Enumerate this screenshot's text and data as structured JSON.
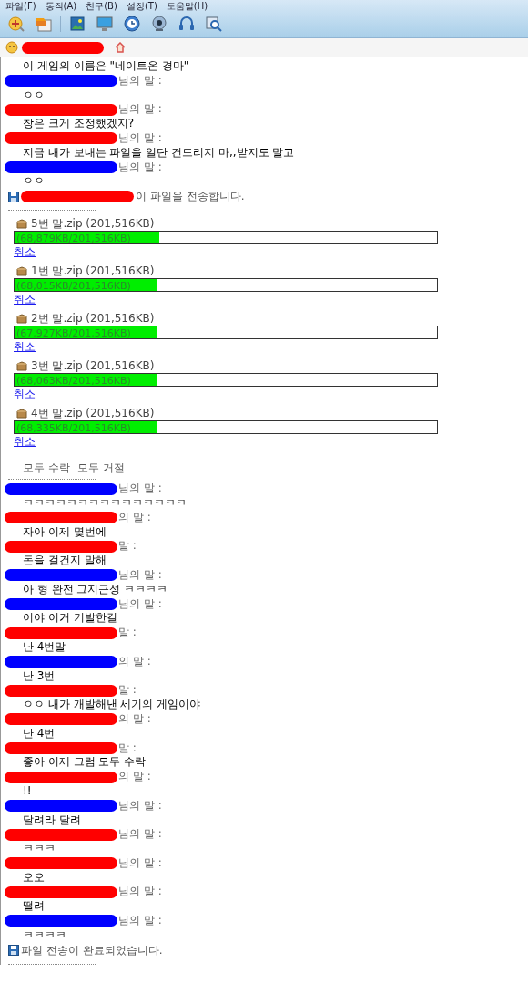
{
  "menu": [
    "파일(F)",
    "동작(A)",
    "친구(B)",
    "설정(T)",
    "도움말(H)"
  ],
  "contact_bar": {
    "color": "#ff0000"
  },
  "log": [
    {
      "kind": "message",
      "text": "이 게임의 이름은 \"네이트온 경마\""
    },
    {
      "kind": "header",
      "color": "#0000ff",
      "text": "님의 말 :"
    },
    {
      "kind": "message",
      "text": "ㅇㅇ"
    },
    {
      "kind": "header",
      "color": "#ff0000",
      "text": "님의 말 :"
    },
    {
      "kind": "message",
      "text": "창은 크게 조정했겠지?"
    },
    {
      "kind": "header",
      "color": "#ff0000",
      "text": "님의 말 :"
    },
    {
      "kind": "message",
      "text": "지금 내가 보내는 파일을 일단 건드리지 마,,받지도 말고"
    },
    {
      "kind": "header",
      "color": "#0000ff",
      "text": "님의 말 :"
    },
    {
      "kind": "message",
      "text": "ㅇㅇ"
    },
    {
      "kind": "system",
      "color": "#ff0000",
      "text": "이 파일을 전송합니다."
    },
    {
      "kind": "separator"
    }
  ],
  "transfers": [
    {
      "file": "5번 말.zip (201,516KB)",
      "progress": "(68,879KB/201,516KB)",
      "level": 0.342,
      "cancel": "취소"
    },
    {
      "file": "1번 말.zip (201,516KB)",
      "progress": "(68,015KB/201,516KB)",
      "level": 0.338,
      "cancel": "취소"
    },
    {
      "file": "2번 말.zip (201,516KB)",
      "progress": "(67,927KB/201,516KB)",
      "level": 0.337,
      "cancel": "취소"
    },
    {
      "file": "3번 말.zip (201,516KB)",
      "progress": "(68,063KB/201,516KB)",
      "level": 0.338,
      "cancel": "취소"
    },
    {
      "file": "4번 말.zip (201,516KB)",
      "progress": "(68,335KB/201,516KB)",
      "level": 0.339,
      "cancel": "취소"
    }
  ],
  "transfer_actions": [
    "모두 수락",
    "모두 거절"
  ],
  "log_after": [
    {
      "kind": "separator"
    },
    {
      "kind": "header",
      "color": "#0000ff",
      "text": "님의 말 :"
    },
    {
      "kind": "message",
      "text": "ㅋㅋㅋㅋㅋㅋㅋㅋㅋㅋㅋㅋㅋㅋㅋ"
    },
    {
      "kind": "header",
      "color": "#ff0000",
      "text": "의 말 :"
    },
    {
      "kind": "message",
      "text": "자아 이제 몇번에"
    },
    {
      "kind": "header",
      "color": "#ff0000",
      "text": "말 :"
    },
    {
      "kind": "message",
      "text": "돈을 걸건지 말해"
    },
    {
      "kind": "header",
      "color": "#0000ff",
      "text": "님의 말 :"
    },
    {
      "kind": "message",
      "text": "아 형 완전 그지근성 ㅋㅋㅋㅋ"
    },
    {
      "kind": "header",
      "color": "#0000ff",
      "text": "님의 말 :"
    },
    {
      "kind": "message",
      "text": "이야 이거 기발한걸"
    },
    {
      "kind": "header",
      "color": "#ff0000",
      "text": "말 :"
    },
    {
      "kind": "message",
      "text": "난 4번말"
    },
    {
      "kind": "header",
      "color": "#0000ff",
      "text": "의 말 :"
    },
    {
      "kind": "message",
      "text": "난 3번"
    },
    {
      "kind": "header",
      "color": "#ff0000",
      "text": "말 :"
    },
    {
      "kind": "message",
      "text": "ㅇㅇ 내가 개발해낸 세기의 게임이야"
    },
    {
      "kind": "header",
      "color": "#ff0000",
      "text": "의 말 :"
    },
    {
      "kind": "message",
      "text": "난 4번"
    },
    {
      "kind": "header",
      "color": "#ff0000",
      "text": "말 :"
    },
    {
      "kind": "message",
      "text": "좋아 이제 그럼 모두 수락"
    },
    {
      "kind": "header",
      "color": "#ff0000",
      "text": "의 말 :"
    },
    {
      "kind": "message",
      "text": "!!"
    },
    {
      "kind": "header",
      "color": "#0000ff",
      "text": "님의 말 :"
    },
    {
      "kind": "message",
      "text": "달려라 달려"
    },
    {
      "kind": "header",
      "color": "#ff0000",
      "text": "님의 말 :"
    },
    {
      "kind": "message",
      "text": "ㅋㅋㅋ"
    },
    {
      "kind": "header",
      "color": "#ff0000",
      "text": "님의 말 :"
    },
    {
      "kind": "message",
      "text": "오오"
    },
    {
      "kind": "header",
      "color": "#ff0000",
      "text": "님의 말 :"
    },
    {
      "kind": "message",
      "text": "떨려"
    },
    {
      "kind": "header",
      "color": "#0000ff",
      "text": "님의 말 :"
    },
    {
      "kind": "message",
      "text": "ㅋㅋㅋㅋ"
    },
    {
      "kind": "system",
      "text": "파일 전송이 완료되었습니다."
    },
    {
      "kind": "separator"
    }
  ]
}
